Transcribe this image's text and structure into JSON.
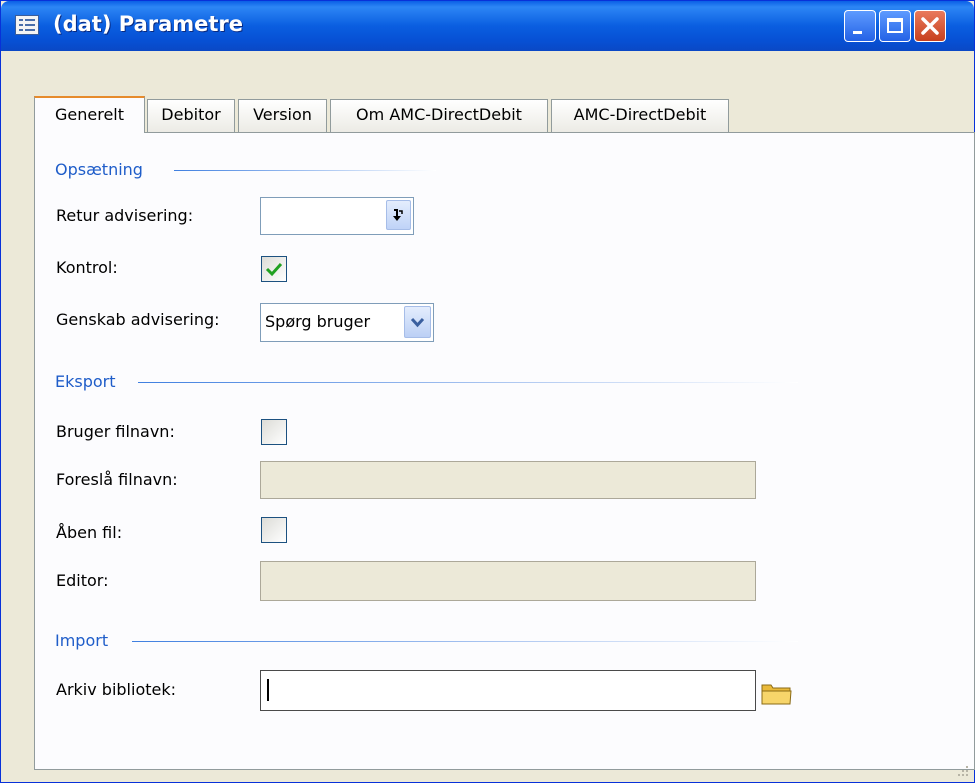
{
  "window": {
    "title": "(dat) Parametre",
    "icon": "form-icon"
  },
  "title_buttons": {
    "minimize": "minimize-icon",
    "maximize": "maximize-icon",
    "close": "close-icon"
  },
  "tabs": [
    {
      "label": "Generelt",
      "active": true
    },
    {
      "label": "Debitor",
      "active": false
    },
    {
      "label": "Version",
      "active": false
    },
    {
      "label": "Om AMC-DirectDebit",
      "active": false
    },
    {
      "label": "AMC-DirectDebit",
      "active": false
    }
  ],
  "sections": {
    "opsaetning": {
      "heading": "Opsætning",
      "retur_label": "Retur advisering:",
      "retur_value": "",
      "kontrol_label": "Kontrol:",
      "kontrol_checked": true,
      "genskab_label": "Genskab advisering:",
      "genskab_value": "Spørg bruger"
    },
    "eksport": {
      "heading": "Eksport",
      "bruger_label": "Bruger filnavn:",
      "bruger_checked": false,
      "foreslaa_label": "Foreslå filnavn:",
      "foreslaa_value": "",
      "aaben_label": "Åben fil:",
      "aaben_checked": false,
      "editor_label": "Editor:",
      "editor_value": ""
    },
    "import": {
      "heading": "Import",
      "arkiv_label": "Arkiv bibliotek:",
      "arkiv_value": ""
    }
  },
  "colors": {
    "title_bar": "#0a5ee0",
    "section_heading": "#1f5dc9",
    "check_mark": "#21a121",
    "tab_highlight": "#e68b2c",
    "window_bg": "#ece9d8"
  }
}
